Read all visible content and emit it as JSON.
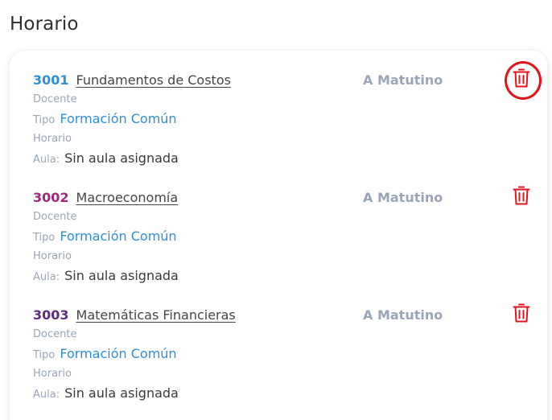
{
  "page": {
    "title": "Horario"
  },
  "labels": {
    "docente": "Docente",
    "tipo": "Tipo",
    "horario": "Horario",
    "aula": "Aula:"
  },
  "courses": [
    {
      "code": "3001",
      "code_color": "#2f8fd0",
      "name": "Fundamentos de Costos",
      "group": "A Matutino",
      "type": "Formación Común",
      "classroom": "Sin aula asignada",
      "delete_icon": "trash-icon",
      "highlighted": true
    },
    {
      "code": "3002",
      "code_color": "#a1287d",
      "name": "Macroeconomía",
      "group": "A Matutino",
      "type": "Formación Común",
      "classroom": "Sin aula asignada",
      "delete_icon": "trash-icon",
      "highlighted": false
    },
    {
      "code": "3003",
      "code_color": "#5c2d82",
      "name": "Matemáticas Financieras",
      "group": "A Matutino",
      "type": "Formación Común",
      "classroom": "Sin aula asignada",
      "delete_icon": "trash-icon",
      "highlighted": false
    }
  ],
  "colors": {
    "accent_blue": "#2f8fd0",
    "muted_label": "#9aa6b8",
    "delete_red": "#e1141b"
  }
}
